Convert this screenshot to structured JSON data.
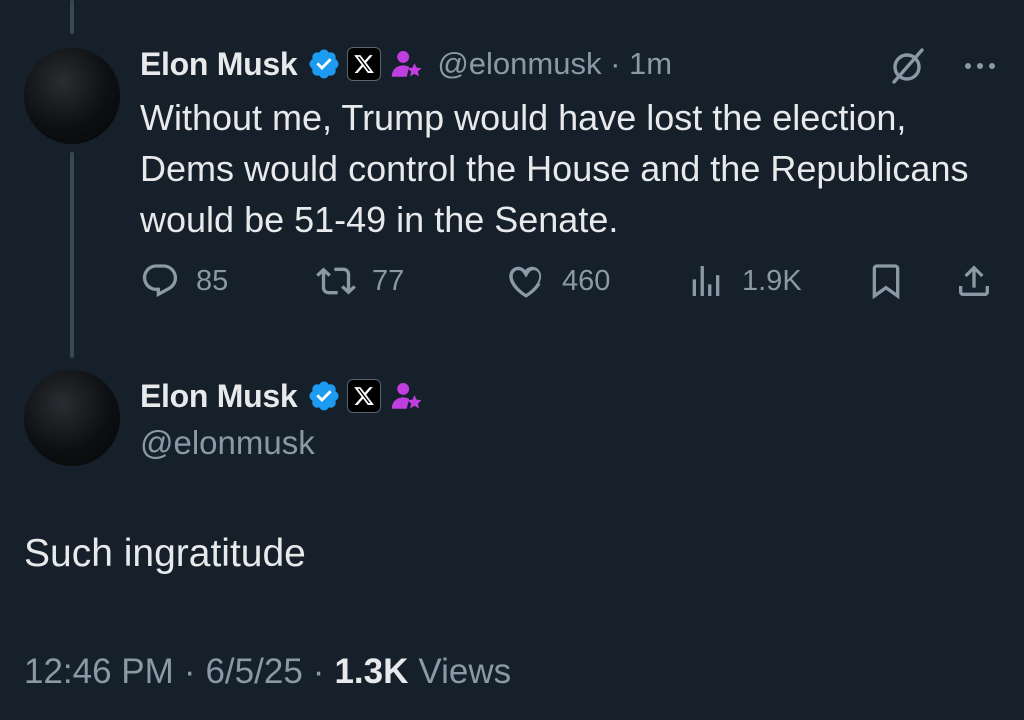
{
  "parent_tweet": {
    "author_name": "Elon Musk",
    "handle": "@elonmusk",
    "time_ago": "1m",
    "text": "Without me, Trump would have lost the election, Dems would control the House and the Republicans would be 51-49 in the Senate.",
    "replies": "85",
    "reposts": "77",
    "likes": "460",
    "views": "1.9K"
  },
  "main_tweet": {
    "author_name": "Elon Musk",
    "handle": "@elonmusk",
    "text": "Such ingratitude",
    "time": "12:46 PM",
    "date": "6/5/25",
    "views_count": "1.3K",
    "views_label": "Views"
  },
  "colors": {
    "background": "#15202b",
    "primary_text": "#e7e9ea",
    "secondary_text": "#8b98a5",
    "verified_blue": "#1d9bf0",
    "affiliate_purple": "#c03ddf"
  },
  "icons": {
    "verified": "verified-badge-icon",
    "x_affiliation": "x-logo-icon",
    "person": "person-star-icon",
    "grok": "grok-icon",
    "more": "more-icon",
    "reply": "reply-icon",
    "repost": "repost-icon",
    "like": "heart-icon",
    "views": "views-icon",
    "bookmark": "bookmark-icon",
    "share": "share-icon"
  }
}
